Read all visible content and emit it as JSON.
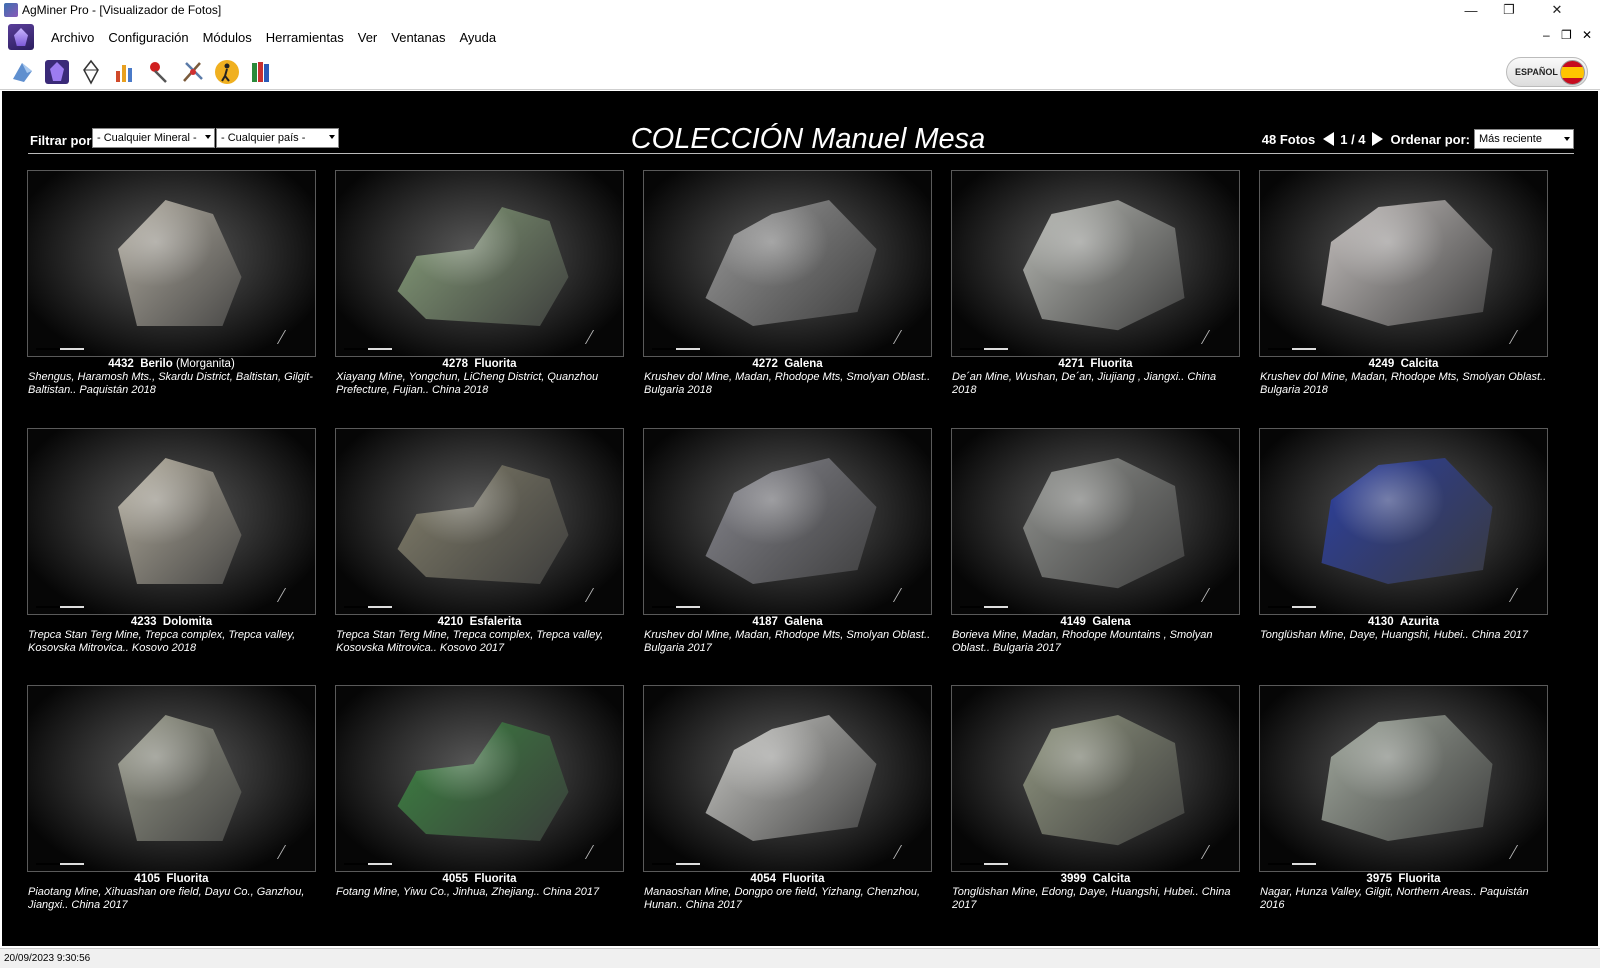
{
  "window": {
    "title": "AgMiner Pro - [Visualizador de Fotos]",
    "minimize": "—",
    "maximize": "❐",
    "close": "✕"
  },
  "menu": {
    "items": [
      "Archivo",
      "Configuración",
      "Módulos",
      "Herramientas",
      "Ver",
      "Ventanas",
      "Ayuda"
    ],
    "mdi_minimize": "–",
    "mdi_restore": "❐",
    "mdi_close": "✕"
  },
  "toolbar": {
    "icons": [
      "rock-hammer-icon",
      "mineral-crystal-icon",
      "diamond-outline-icon",
      "chart-bars-icon",
      "pin-tools-icon",
      "dig-tools-icon",
      "hiker-icon",
      "books-icon"
    ]
  },
  "language": {
    "label": "ESPAÑOL"
  },
  "filters": {
    "label": "Filtrar por:",
    "mineral": "- Cualquier Mineral -",
    "country": "- Cualquier país -"
  },
  "collection_title": "COLECCIÓN Manuel Mesa",
  "paging": {
    "count": "48 Fotos",
    "page": "1 / 4",
    "sort_label": "Ordenar por:",
    "sort_value": "Más reciente"
  },
  "cards": [
    {
      "num": "4432",
      "name": "Berilo",
      "variety": "(Morganita)",
      "locality": "Shengus, Haramosh Mts., Skardu District, Baltistan, Gilgit-Baltistan.. Paquistán  2018",
      "color": "#c8c2b4"
    },
    {
      "num": "4278",
      "name": "Fluorita",
      "variety": "",
      "locality": "Xiayang Mine, Yongchun, LiCheng District, Quanzhou Prefecture, Fujian.. China  2018",
      "color": "#8ea880"
    },
    {
      "num": "4272",
      "name": "Galena",
      "variety": "",
      "locality": "Krushev dol Mine, Madan, Rhodope Mts, Smolyan Oblast.. Bulgaria  2018",
      "color": "#a0a0a0"
    },
    {
      "num": "4271",
      "name": "Fluorita",
      "variety": "",
      "locality": "De´an Mine, Wushan, De´an, Jiujiang , Jiangxi.. China  2018",
      "color": "#c4c6c0"
    },
    {
      "num": "4249",
      "name": "Calcita",
      "variety": "",
      "locality": "Krushev dol Mine, Madan, Rhodope Mts, Smolyan Oblast.. Bulgaria  2018",
      "color": "#cfcac8"
    },
    {
      "num": "4233",
      "name": "Dolomita",
      "variety": "",
      "locality": "Trepca Stan Terg Mine, Trepca complex, Trepca valley, Kosovska Mitrovica.. Kosovo  2018",
      "color": "#c9c2b0"
    },
    {
      "num": "4210",
      "name": "Esfalerita",
      "variety": "",
      "locality": "Trepca Stan Terg Mine, Trepca complex, Trepca valley, Kosovska Mitrovica.. Kosovo  2017",
      "color": "#8a8670"
    },
    {
      "num": "4187",
      "name": "Galena",
      "variety": "",
      "locality": "Krushev dol Mine, Madan, Rhodope Mts, Smolyan Oblast.. Bulgaria  2017",
      "color": "#8c8c94"
    },
    {
      "num": "4149",
      "name": "Galena",
      "variety": "",
      "locality": "Borieva Mine, Madan, Rhodope Mountains , Smolyan Oblast.. Bulgaria  2017",
      "color": "#9a9c98"
    },
    {
      "num": "4130",
      "name": "Azurita",
      "variety": "",
      "locality": "Tonglüshan Mine, Daye, Huangshi, Hubei.. China  2017",
      "color": "#2a3fa8"
    },
    {
      "num": "4105",
      "name": "Fluorita",
      "variety": "",
      "locality": "Piaotang Mine, Xihuashan ore field, Dayu Co., Ganzhou, Jiangxi.. China  2017",
      "color": "#a8aa98"
    },
    {
      "num": "4055",
      "name": "Fluorita",
      "variety": "",
      "locality": "Fotang Mine, Yiwu Co., Jinhua, Zhejiang.. China  2017",
      "color": "#3c8a42"
    },
    {
      "num": "4054",
      "name": "Fluorita",
      "variety": "",
      "locality": "Manaoshan Mine, Dongpo ore field, Yizhang, Chenzhou, Hunan.. China  2017",
      "color": "#d4d4d0"
    },
    {
      "num": "3999",
      "name": "Calcita",
      "variety": "",
      "locality": "Tonglüshan Mine, Edong, Daye, Huangshi, Hubei.. China  2017",
      "color": "#9aa088"
    },
    {
      "num": "3975",
      "name": "Fluorita",
      "variety": "",
      "locality": "Nagar, Hunza Valley, Gilgit, Northern Areas.. Paquistán  2016",
      "color": "#a8b0a4"
    }
  ],
  "status": {
    "datetime": "20/09/2023 9:30:56"
  }
}
